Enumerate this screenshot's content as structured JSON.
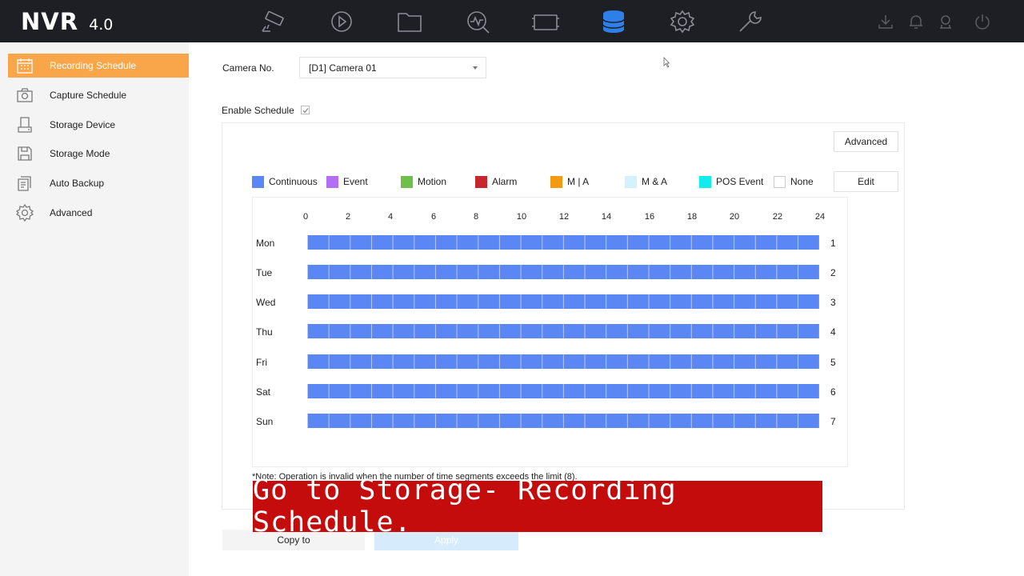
{
  "app": {
    "brand": "NVR",
    "version": "4.0"
  },
  "topnav": [
    {
      "name": "live-view-icon"
    },
    {
      "name": "playback-icon"
    },
    {
      "name": "file-management-icon"
    },
    {
      "name": "smart-analysis-icon"
    },
    {
      "name": "camera-icon"
    },
    {
      "name": "storage-icon",
      "active": true
    },
    {
      "name": "configuration-icon"
    },
    {
      "name": "maintenance-icon"
    }
  ],
  "colors": {
    "accent": "#f9a64a",
    "active_nav": "#2f7fe8",
    "schedule_continuous": "#5b87f4",
    "caption_bg": "#c40c0c"
  },
  "sidebar": {
    "items": [
      {
        "label": "Recording Schedule",
        "icon": "calendar-icon",
        "active": true
      },
      {
        "label": "Capture Schedule",
        "icon": "camera-icon"
      },
      {
        "label": "Storage Device",
        "icon": "hdd-icon"
      },
      {
        "label": "Storage Mode",
        "icon": "save-icon"
      },
      {
        "label": "Auto Backup",
        "icon": "backup-icon"
      },
      {
        "label": "Advanced",
        "icon": "gear-icon"
      }
    ]
  },
  "form": {
    "camera_label": "Camera No.",
    "camera_value": "[D1] Camera 01",
    "enable_label": "Enable Schedule",
    "enable_checked": true
  },
  "buttons": {
    "advanced": "Advanced",
    "edit": "Edit",
    "copy_to": "Copy to",
    "apply": "Apply"
  },
  "legend": [
    {
      "label": "Continuous",
      "color": "#5b87f4"
    },
    {
      "label": "Event",
      "color": "#b26ff5"
    },
    {
      "label": "Motion",
      "color": "#6fbf4a"
    },
    {
      "label": "Alarm",
      "color": "#c8262f"
    },
    {
      "label": "M | A",
      "color": "#f39a12"
    },
    {
      "label": "M & A",
      "color": "#d3f2fd"
    },
    {
      "label": "POS Event",
      "color": "#12ecec"
    },
    {
      "label": "None",
      "color": "#ffffff"
    }
  ],
  "schedule": {
    "hours": [
      "0",
      "2",
      "4",
      "6",
      "8",
      "10",
      "12",
      "14",
      "16",
      "18",
      "20",
      "22",
      "24"
    ],
    "days": [
      {
        "day": "Mon",
        "num": "1",
        "type": "Continuous"
      },
      {
        "day": "Tue",
        "num": "2",
        "type": "Continuous"
      },
      {
        "day": "Wed",
        "num": "3",
        "type": "Continuous"
      },
      {
        "day": "Thu",
        "num": "4",
        "type": "Continuous"
      },
      {
        "day": "Fri",
        "num": "5",
        "type": "Continuous"
      },
      {
        "day": "Sat",
        "num": "6",
        "type": "Continuous"
      },
      {
        "day": "Sun",
        "num": "7",
        "type": "Continuous"
      }
    ]
  },
  "note": "*Note: Operation is invalid when the number of time segments exceeds the limit (8).",
  "caption": "Go to Storage- Recording Schedule."
}
